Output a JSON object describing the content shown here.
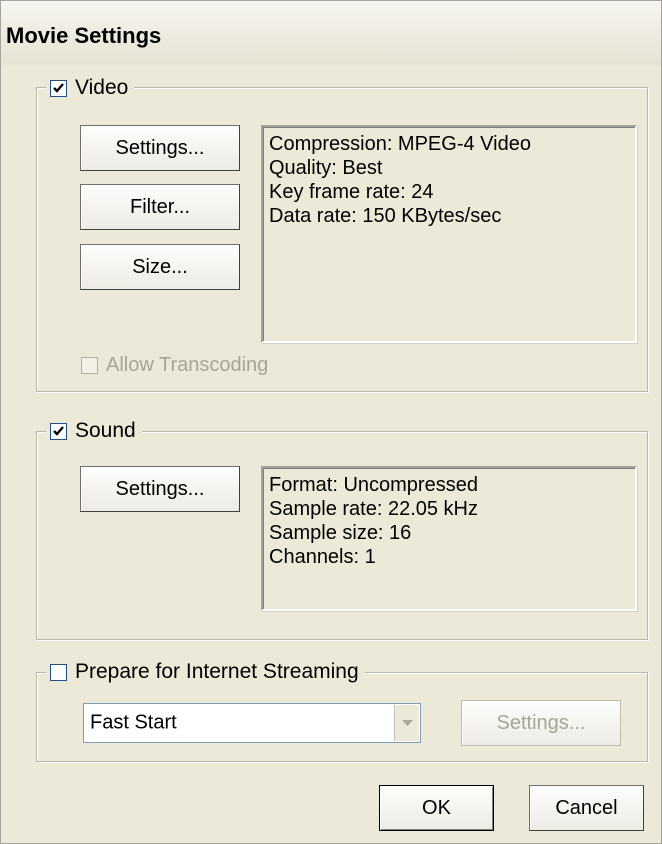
{
  "window": {
    "title": "Movie Settings"
  },
  "video": {
    "label": "Video",
    "checked": true,
    "settings_button": "Settings...",
    "filter_button": "Filter...",
    "size_button": "Size...",
    "info": [
      "Compression: MPEG-4 Video",
      "Quality: Best",
      "Key frame rate: 24",
      "Data rate: 150 KBytes/sec"
    ],
    "allow_transcoding": {
      "label": "Allow Transcoding",
      "checked": false,
      "enabled": false
    }
  },
  "sound": {
    "label": "Sound",
    "checked": true,
    "settings_button": "Settings...",
    "info": [
      "Format: Uncompressed",
      "Sample rate: 22.05 kHz",
      "Sample size: 16",
      "Channels: 1"
    ]
  },
  "streaming": {
    "label": "Prepare for Internet Streaming",
    "checked": false,
    "option_selected": "Fast Start",
    "settings_button": "Settings..."
  },
  "footer": {
    "ok_button": "OK",
    "cancel_button": "Cancel"
  },
  "icons": {
    "checkmark": "checkmark-icon",
    "dropdown": "chevron-down-icon"
  }
}
